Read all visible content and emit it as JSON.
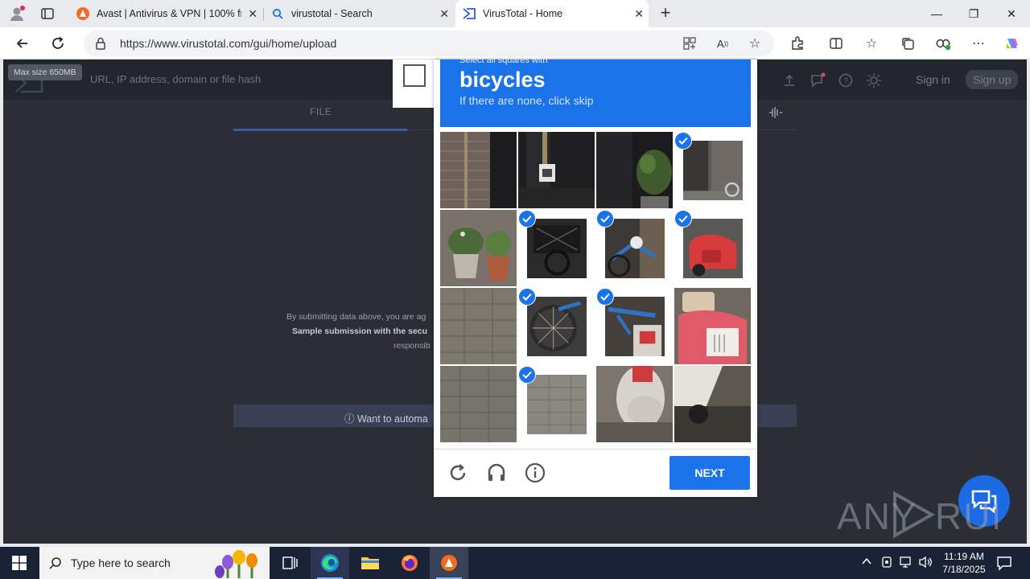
{
  "browser": {
    "tabs": [
      {
        "title": "Avast | Antivirus & VPN | 100% free",
        "icon": "avast-icon"
      },
      {
        "title": "virustotal - Search",
        "icon": "search-icon"
      },
      {
        "title": "VirusTotal - Home",
        "icon": "virustotal-icon",
        "active": true
      }
    ],
    "url": "https://www.virustotal.com/gui/home/upload"
  },
  "virustotal": {
    "max_size_tip": "Max size 650MB",
    "search_placeholder": "URL, IP address, domain or file hash",
    "sign_in": "Sign in",
    "sign_up": "Sign up",
    "tab_file": "FILE",
    "disclaimer_line1": "By submitting data above, you are ag",
    "disclaimer_line2": "Sample submission with the secu",
    "disclaimer_line3": "responsib",
    "automate_text": "ⓘ Want to automa"
  },
  "captcha": {
    "instruction": "Select all squares with",
    "target_word": "bicycles",
    "skip_hint": "If there are none, click skip",
    "next_label": "NEXT",
    "tiles": [
      {
        "selected": false,
        "scene": "brick-wall-door"
      },
      {
        "selected": false,
        "scene": "black-door-sign"
      },
      {
        "selected": false,
        "scene": "black-door-plant"
      },
      {
        "selected": true,
        "scene": "bike-wall"
      },
      {
        "selected": false,
        "scene": "potted-plants"
      },
      {
        "selected": true,
        "scene": "bike-basket"
      },
      {
        "selected": true,
        "scene": "blue-bike-frame"
      },
      {
        "selected": true,
        "scene": "red-scooter-front"
      },
      {
        "selected": false,
        "scene": "pavement"
      },
      {
        "selected": true,
        "scene": "blue-bike-wheel"
      },
      {
        "selected": true,
        "scene": "blue-bike-scooter"
      },
      {
        "selected": false,
        "scene": "red-scooter-seat"
      },
      {
        "selected": false,
        "scene": "pavement-2"
      },
      {
        "selected": true,
        "scene": "pavement-3"
      },
      {
        "selected": false,
        "scene": "scooter-blur"
      },
      {
        "selected": false,
        "scene": "scooter-base"
      }
    ]
  },
  "taskbar": {
    "search_placeholder": "Type here to search",
    "time": "11:19 AM",
    "date": "7/18/2025"
  },
  "watermark": "ANY RUN"
}
